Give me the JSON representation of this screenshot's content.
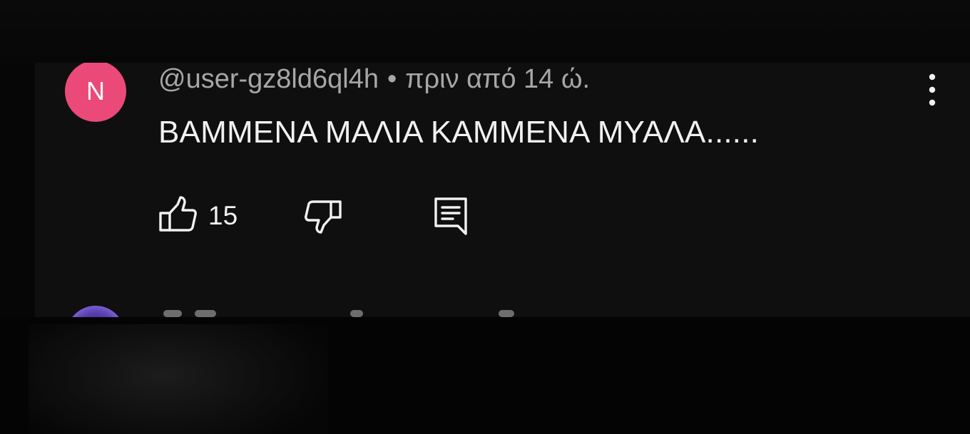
{
  "comment": {
    "avatar_letter": "N",
    "avatar_color": "#eb4a78",
    "author": "@user-gz8ld6ql4h",
    "separator": "•",
    "timestamp": "πριν από 14 ώ.",
    "text": "ΒΑΜΜΕΝΑ ΜΑΛΙΑ ΚΑΜΜΕΝΑ ΜΥΑΛΑ......",
    "like_count": "15"
  },
  "icons": {
    "like": "thumb-up-icon",
    "dislike": "thumb-down-icon",
    "reply": "reply-comment-icon",
    "more": "more-vertical-icon"
  },
  "theme": {
    "panel_bg": "#0f0f0f",
    "text_primary": "#f1f1f1",
    "text_secondary": "#a7a7a7"
  }
}
